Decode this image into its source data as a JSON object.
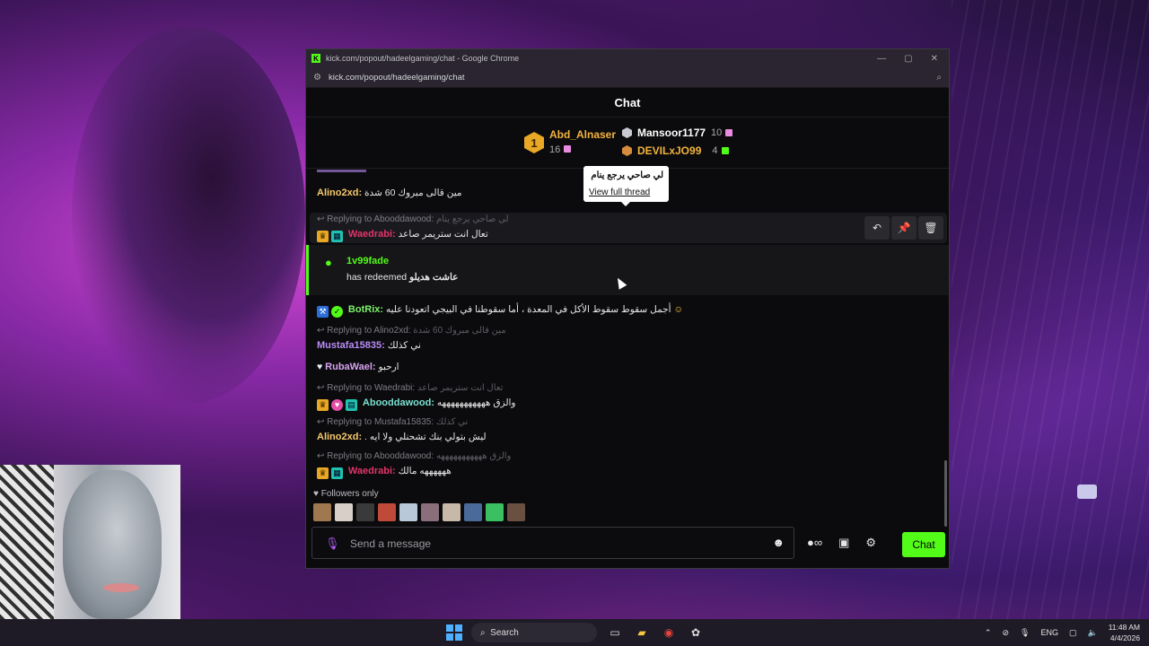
{
  "browser": {
    "title": "kick.com/popout/hadeelgaming/chat - Google Chrome",
    "url": "kick.com/popout/hadeelgaming/chat"
  },
  "chat": {
    "header": "Chat",
    "leaderboard": {
      "first": {
        "name": "Abd_Alnaser",
        "count": "16",
        "rank": "1"
      },
      "second": {
        "name": "Mansoor1177",
        "count": "10"
      },
      "third": {
        "name": "DEVILxJO99",
        "count": "4"
      }
    },
    "tooltip": {
      "text": "لي صاحي يرجع ينام",
      "link": "View full thread"
    },
    "messages": {
      "m0": {
        "user": "Alino2xd:",
        "text": "مين قالى مبروك 60 شدة"
      },
      "m1_reply": {
        "label": "Replying to Abooddawood:",
        "text": "لي صاحي يرجع ينام"
      },
      "m1": {
        "user": "Waedrabi:",
        "text": "تعال انت ستريمر صاعد"
      },
      "redeem": {
        "user": "1v99fade",
        "text": "has redeemed",
        "reward": "عاشت هديلو"
      },
      "m2": {
        "user": "BotRix:",
        "text": "أجمل سقوط سقوط الأكل في المعدة ، أما سقوطنا في البيجي اتعودنا عليه"
      },
      "m3_reply": {
        "label": "Replying to Alino2xd:",
        "text": "مين قالى مبروك 60 شدة"
      },
      "m3": {
        "user": "Mustafa15835:",
        "text": "ني كذلك"
      },
      "m4": {
        "user": "RubaWael:",
        "text": "ارحبو"
      },
      "m5_reply": {
        "label": "Replying to Waedrabi:",
        "text": "تعال انت ستريمر صاعد"
      },
      "m5": {
        "user": "Abooddawood:",
        "text": "والزق هههههههههههه"
      },
      "m6_reply": {
        "label": "Replying to Mustafa15835:",
        "text": "ني كذلك"
      },
      "m6": {
        "user": "Alino2xd:",
        "text": ". ليش بتولي بنك تشحنلي ولا ايه"
      },
      "m7_reply": {
        "label": "Replying to Abooddawood:",
        "text": "والزق هههههههههههه"
      },
      "m7": {
        "user": "Waedrabi:",
        "text": "ههههههه مالك"
      }
    },
    "followers_only": "Followers only",
    "composer": {
      "placeholder": "Send a message"
    },
    "send_button": "Chat"
  },
  "colors": {
    "kick_green": "#53fc18",
    "gold": "#f2b33d",
    "waedrabi": "#e3346a",
    "abooddawood": "#7be2d1",
    "mustafa": "#b98cf6",
    "alino": "#f6c96a",
    "botrix": "#7cf06a",
    "rubawael": "#d7a3f0"
  },
  "taskbar": {
    "search_label": "Search",
    "language": "ENG",
    "time": "11:48 AM",
    "date": "4/4/2026"
  }
}
